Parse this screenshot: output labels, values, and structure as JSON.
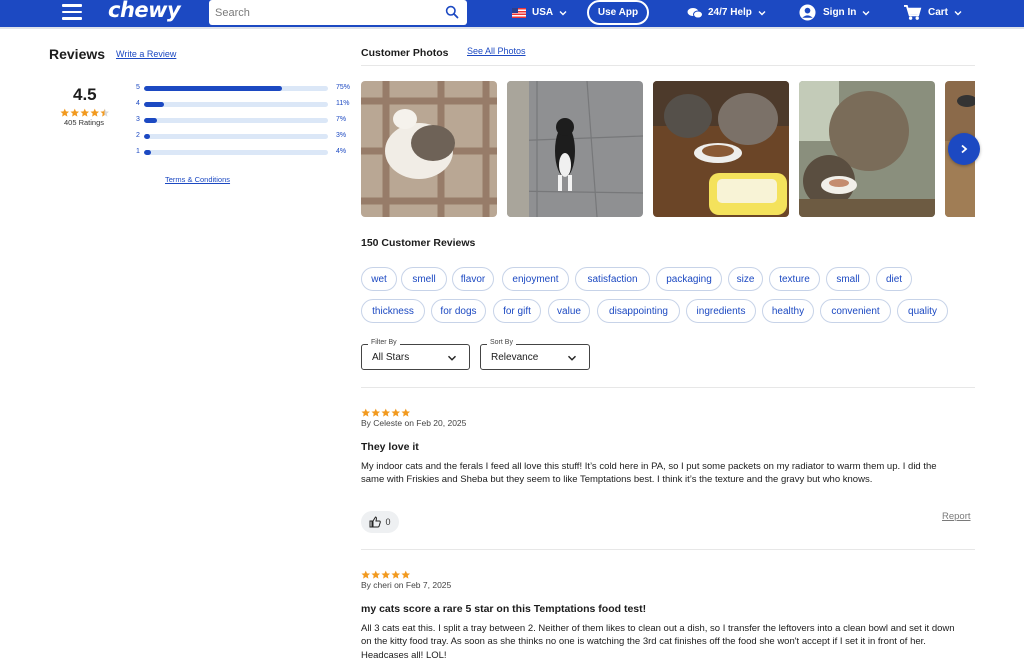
{
  "header": {
    "logo": "chewy",
    "search_placeholder": "Search",
    "country": "USA",
    "use_app": "Use App",
    "help": "24/7 Help",
    "sign_in": "Sign In",
    "cart": "Cart",
    "brand_color": "#1c49c2"
  },
  "reviews_summary": {
    "title": "Reviews",
    "write_review": "Write a Review",
    "average": "4.5",
    "average_stars": 4.5,
    "ratings_count": "405 Ratings",
    "histogram": [
      {
        "star": "5",
        "percent_label": "75%",
        "fraction": 0.75
      },
      {
        "star": "4",
        "percent_label": "11%",
        "fraction": 0.11
      },
      {
        "star": "3",
        "percent_label": "7%",
        "fraction": 0.07
      },
      {
        "star": "2",
        "percent_label": "3%",
        "fraction": 0.03
      },
      {
        "star": "1",
        "percent_label": "4%",
        "fraction": 0.04
      }
    ],
    "terms": "Terms & Conditions"
  },
  "photos": {
    "title": "Customer Photos",
    "see_all": "See All Photos",
    "next_icon": "chevron-right-icon"
  },
  "review_count_title": "150 Customer Reviews",
  "chips_row1": [
    "wet",
    "smell",
    "flavor",
    "enjoyment",
    "satisfaction",
    "packaging",
    "size",
    "texture",
    "small",
    "diet"
  ],
  "chips_row2": [
    "thickness",
    "for dogs",
    "for gift",
    "value",
    "disappointing",
    "ingredients",
    "healthy",
    "convenient",
    "quality"
  ],
  "filter": {
    "label": "Filter By",
    "value": "All Stars"
  },
  "sort": {
    "label": "Sort By",
    "value": "Relevance"
  },
  "reviews": [
    {
      "stars": 5,
      "meta": "By Celeste on Feb 20, 2025",
      "title": "They love it",
      "body": "My indoor cats and the ferals I feed all love this stuff! It’s cold here in PA, so I put some packets on my radiator to warm them up. I did the same with Friskies and Sheba but they seem to like Temptations best. I think it’s the texture and the gravy but who knows.",
      "helpful_count": "0",
      "report": "Report"
    },
    {
      "stars": 5,
      "meta": "By cheri on Feb 7, 2025",
      "title": "my cats score a rare 5 star on this Temptations food test!",
      "body": "All 3 cats eat this. I split a tray between 2. Neither of them likes to clean out a dish, so I transfer the leftovers into a clean bowl and set it down on the kitty food tray. As soon as she thinks no one is watching the 3rd cat finishes off the food she won't accept if I set it in front of her. Headcases all! LOL!"
    }
  ],
  "colors": {
    "star": "#f29a1f",
    "link": "#1c49c2",
    "bar_track": "#dbe7f7"
  }
}
